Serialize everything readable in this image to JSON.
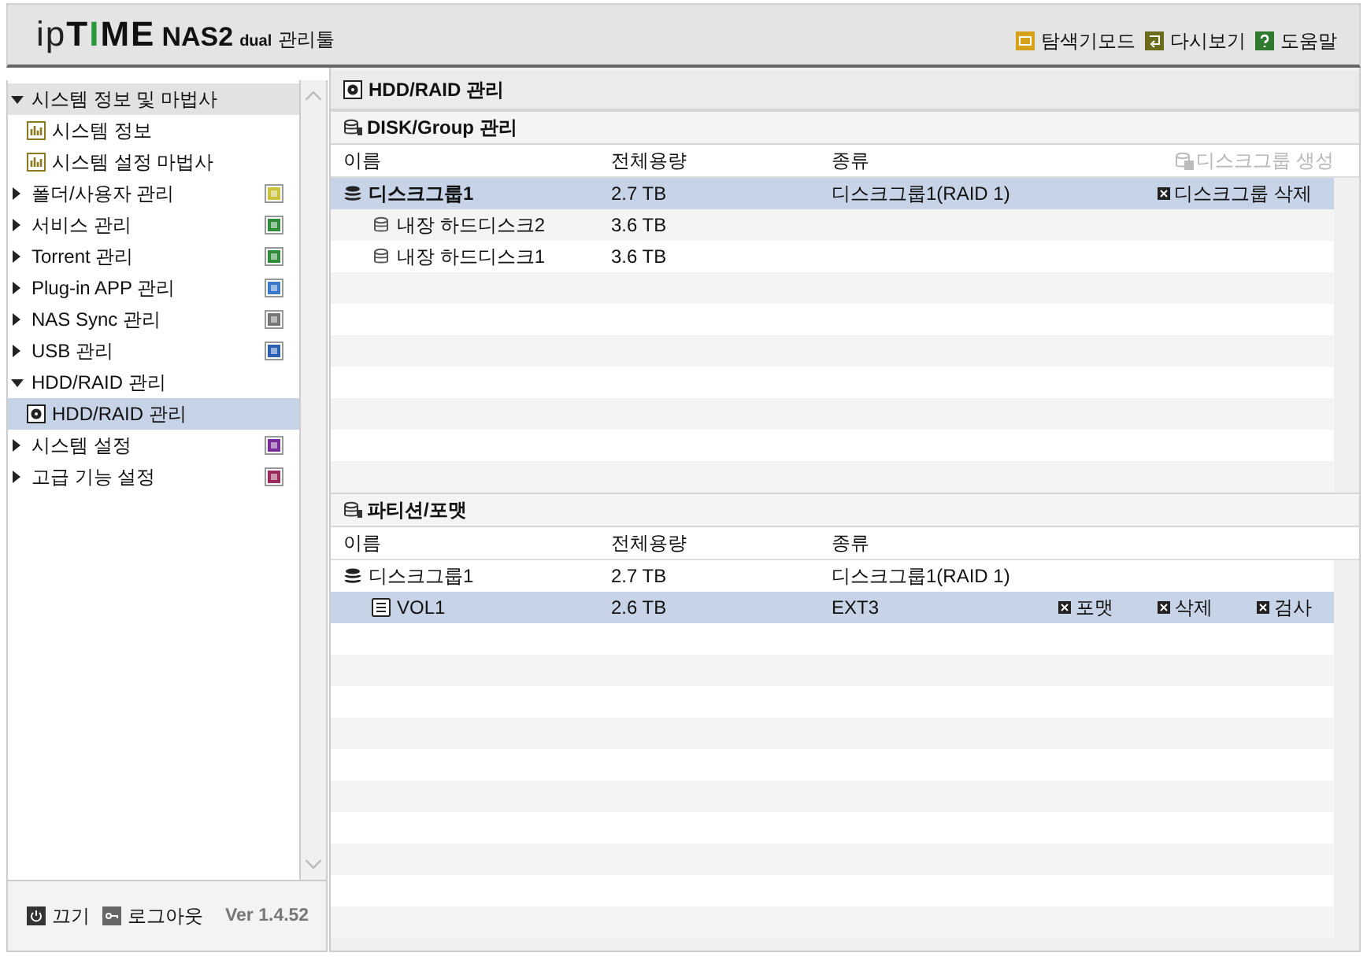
{
  "header": {
    "logo": [
      {
        "text": "ip",
        "kind": "light"
      },
      {
        "text": "T",
        "kind": "heavy"
      },
      {
        "text": "I",
        "kind": "accent"
      },
      {
        "text": "ME",
        "kind": "heavy"
      }
    ],
    "product": "NAS2",
    "edition": "dual",
    "suffix": "관리툴",
    "links": [
      {
        "label": "탐색기모드",
        "kind": "explorer"
      },
      {
        "label": "다시보기",
        "kind": "refresh"
      },
      {
        "label": "도움말",
        "kind": "help"
      }
    ]
  },
  "sidebar": {
    "items": [
      {
        "label": "시스템 정보 및 마법사",
        "expanded": true,
        "selected": false,
        "children": [
          {
            "label": "시스템 정보",
            "kind": "chart",
            "selected": false
          },
          {
            "label": "시스템 설정 마법사",
            "kind": "chart",
            "selected": false
          }
        ]
      },
      {
        "label": "폴더/사용자 관리",
        "expanded": false,
        "selected": false,
        "kind": "folder"
      },
      {
        "label": "서비스 관리",
        "expanded": false,
        "selected": false,
        "kind": "service"
      },
      {
        "label": "Torrent 관리",
        "expanded": false,
        "selected": false,
        "kind": "torrent"
      },
      {
        "label": "Plug-in APP 관리",
        "expanded": false,
        "selected": false,
        "kind": "plugin"
      },
      {
        "label": "NAS Sync 관리",
        "expanded": false,
        "selected": false,
        "kind": "cloud"
      },
      {
        "label": "USB 관리",
        "expanded": false,
        "selected": false,
        "kind": "usb"
      },
      {
        "label": "HDD/RAID 관리",
        "expanded": true,
        "selected": false,
        "children": [
          {
            "label": "HDD/RAID 관리",
            "kind": "disk",
            "selected": true
          }
        ]
      },
      {
        "label": "시스템 설정",
        "expanded": false,
        "selected": false,
        "kind": "gear"
      },
      {
        "label": "고급 기능 설정",
        "expanded": false,
        "selected": false,
        "kind": "gear2"
      }
    ],
    "footer": {
      "power": "끄기",
      "logout": "로그아웃",
      "version": "Ver 1.4.52"
    }
  },
  "page_title": "HDD/RAID 관리",
  "sections": [
    {
      "title": "DISK/Group 관리",
      "columns": [
        "이름",
        "전체용량",
        "종류"
      ],
      "header_action": {
        "label": "디스크그룹 생성",
        "disabled": true
      },
      "rows": [
        {
          "kind": "group",
          "name": "디스크그룹1",
          "bold": true,
          "size": "2.7 TB",
          "type": "디스크그룹1(RAID 1)",
          "selected": true,
          "actions": [
            "디스크그룹 삭제"
          ]
        },
        {
          "kind": "disk",
          "name": "내장 하드디스크2",
          "bold": false,
          "size": "3.6 TB",
          "selected": false
        },
        {
          "kind": "disk",
          "name": "내장 하드디스크1",
          "bold": false,
          "size": "3.6 TB",
          "selected": false
        }
      ]
    },
    {
      "title": "파티션/포맷",
      "columns": [
        "이름",
        "전체용량",
        "종류"
      ],
      "rows": [
        {
          "kind": "group",
          "name": "디스크그룹1",
          "bold": false,
          "size": "2.7 TB",
          "type": "디스크그룹1(RAID 1)",
          "selected": false
        },
        {
          "kind": "volume",
          "name": "VOL1",
          "bold": false,
          "size": "2.6 TB",
          "type": "EXT3",
          "selected": true,
          "actions": [
            "포맷",
            "삭제",
            "검사"
          ]
        }
      ]
    }
  ]
}
